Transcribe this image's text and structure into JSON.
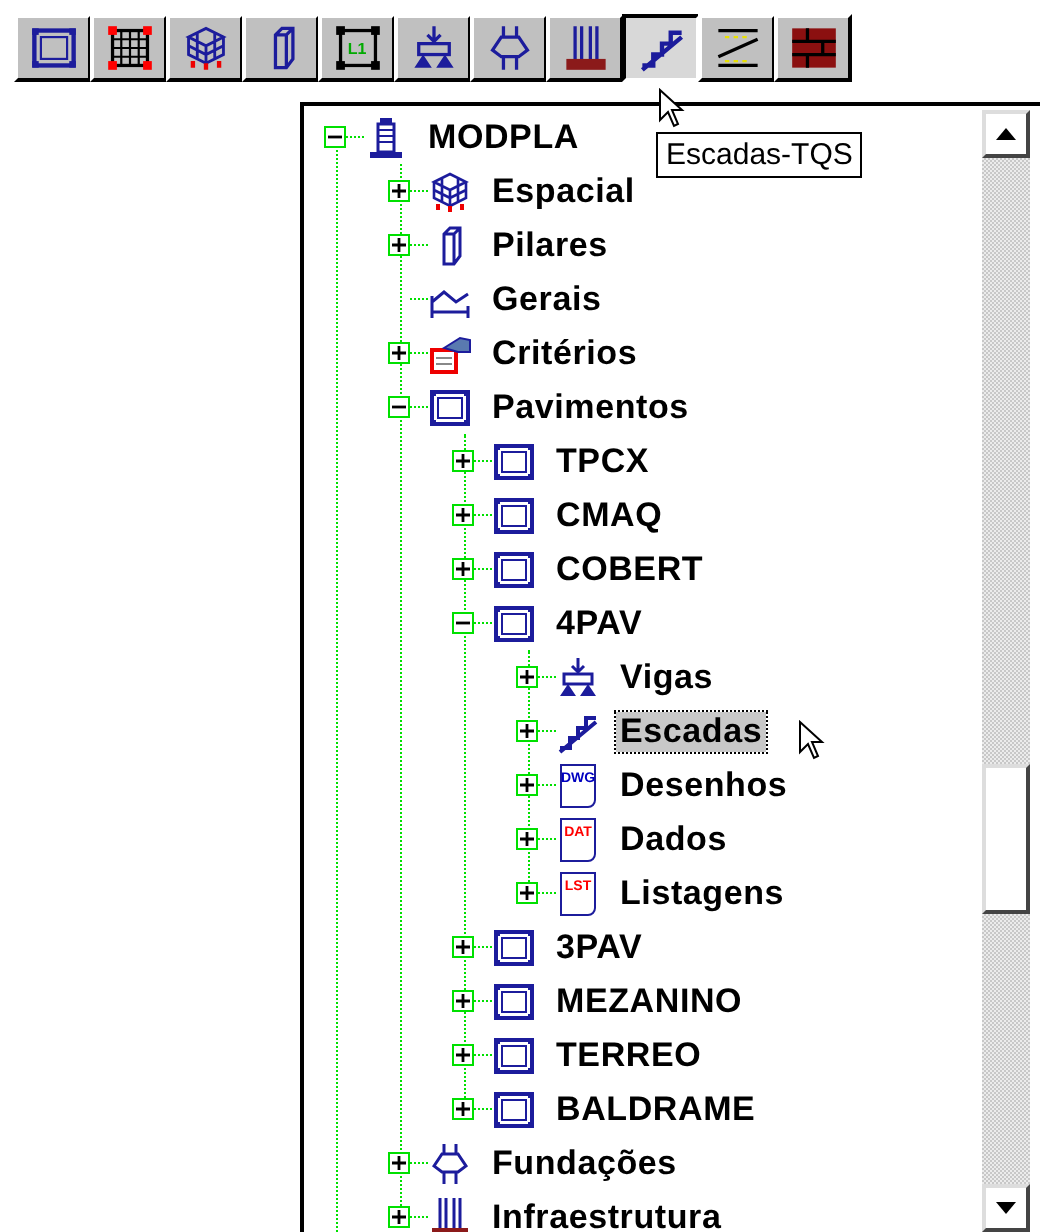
{
  "toolbar": [
    {
      "kind": "frame",
      "selected": false
    },
    {
      "kind": "grid",
      "selected": false
    },
    {
      "kind": "space-frame",
      "selected": false
    },
    {
      "kind": "pillar",
      "selected": false
    },
    {
      "kind": "slab",
      "badge": "L1",
      "selected": false
    },
    {
      "kind": "beam",
      "selected": false
    },
    {
      "kind": "foundation",
      "selected": false
    },
    {
      "kind": "infra",
      "selected": false
    },
    {
      "kind": "stairs",
      "selected": true
    },
    {
      "kind": "ramp",
      "selected": false
    },
    {
      "kind": "brick",
      "selected": false
    }
  ],
  "tooltip": {
    "text": "Escadas-TQS"
  },
  "tree": [
    {
      "label": "MODPLA",
      "kind": "building",
      "expanded": true,
      "selected": false,
      "children": [
        {
          "label": "Espacial",
          "kind": "space-frame",
          "expanded": false,
          "selected": false
        },
        {
          "label": "Pilares",
          "kind": "pillar",
          "expanded": false,
          "selected": false
        },
        {
          "label": "Gerais",
          "kind": "general",
          "selected": false
        },
        {
          "label": "Critérios",
          "kind": "criteria",
          "expanded": false,
          "selected": false
        },
        {
          "label": "Pavimentos",
          "kind": "frame",
          "expanded": true,
          "selected": false,
          "children": [
            {
              "label": "TPCX",
              "kind": "frame",
              "expanded": false,
              "selected": false
            },
            {
              "label": "CMAQ",
              "kind": "frame",
              "expanded": false,
              "selected": false
            },
            {
              "label": "COBERT",
              "kind": "frame",
              "expanded": false,
              "selected": false
            },
            {
              "label": "4PAV",
              "kind": "frame",
              "expanded": true,
              "selected": false,
              "children": [
                {
                  "label": "Vigas",
                  "kind": "beam",
                  "expanded": false,
                  "selected": false
                },
                {
                  "label": "Escadas",
                  "kind": "stairs",
                  "expanded": false,
                  "selected": true
                },
                {
                  "label": "Desenhos",
                  "kind": "doc",
                  "badge": "DWG",
                  "color": "#0000c0",
                  "expanded": false,
                  "selected": false
                },
                {
                  "label": "Dados",
                  "kind": "doc",
                  "badge": "DAT",
                  "color": "#ff0000",
                  "expanded": false,
                  "selected": false
                },
                {
                  "label": "Listagens",
                  "kind": "doc",
                  "badge": "LST",
                  "color": "#ff0000",
                  "expanded": false,
                  "selected": false
                }
              ]
            },
            {
              "label": "3PAV",
              "kind": "frame",
              "expanded": false,
              "selected": false
            },
            {
              "label": "MEZANINO",
              "kind": "frame",
              "expanded": false,
              "selected": false
            },
            {
              "label": "TERREO",
              "kind": "frame",
              "expanded": false,
              "selected": false
            },
            {
              "label": "BALDRAME",
              "kind": "frame",
              "expanded": false,
              "selected": false
            }
          ]
        },
        {
          "label": "Fundações",
          "kind": "foundation",
          "expanded": false,
          "selected": false
        },
        {
          "label": "Infraestrutura",
          "kind": "infra",
          "expanded": false,
          "selected": false
        }
      ]
    }
  ]
}
